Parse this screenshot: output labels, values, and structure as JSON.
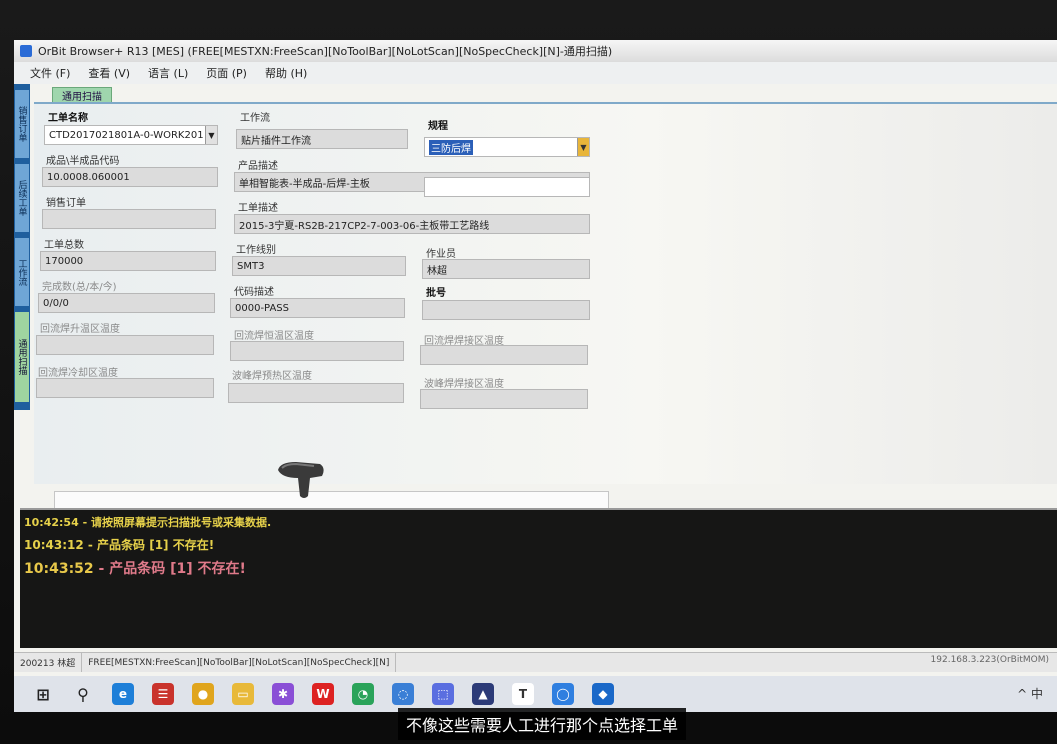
{
  "window": {
    "title": "OrBit Browser+ R13 [MES] (FREE[MESTXN:FreeScan][NoToolBar][NoLotScan][NoSpecCheck][N]-通用扫描)"
  },
  "menu": [
    "文件 (F)",
    "查看 (V)",
    "语言 (L)",
    "页面 (P)",
    "帮助 (H)"
  ],
  "side_tabs": [
    "销售订单",
    "后续工单",
    "工作流",
    "通用扫描"
  ],
  "form_tab": "通用扫描",
  "fields": {
    "work_order_name": {
      "label": "工单名称",
      "value": "CTD2017021801A-0-WORK201"
    },
    "product_code": {
      "label": "成品\\半成品代码",
      "value": "10.0008.060001"
    },
    "sales_order": {
      "label": "销售订单",
      "value": ""
    },
    "order_total": {
      "label": "工单总数",
      "value": "170000"
    },
    "completed": {
      "label": "完成数(总/本/今)",
      "value": "0/0/0"
    },
    "reflow_rise": {
      "label": "回流焊升温区温度",
      "value": ""
    },
    "reflow_cool": {
      "label": "回流焊冷却区温度",
      "value": ""
    },
    "workflow": {
      "label": "工作流",
      "value": "贴片插件工作流"
    },
    "product_desc": {
      "label": "产品描述",
      "value": "单相智能表-半成品-后焊-主板"
    },
    "order_desc": {
      "label": "工单描述",
      "value": "2015-3宁夏-RS2B-217CP2-7-003-06-主板带工艺路线"
    },
    "line": {
      "label": "工作线别",
      "value": "SMT3"
    },
    "code_desc": {
      "label": "代码描述",
      "value": "0000-PASS"
    },
    "reflow_const": {
      "label": "回流焊恒温区温度",
      "value": ""
    },
    "wave_preheat": {
      "label": "波峰焊预热区温度",
      "value": ""
    },
    "procedure": {
      "label": "规程",
      "value": "三防后焊"
    },
    "operator": {
      "label": "作业员",
      "value": "林超"
    },
    "batch": {
      "label": "批号",
      "value": ""
    },
    "reflow_weld": {
      "label": "回流焊焊接区温度",
      "value": ""
    },
    "wave_weld": {
      "label": "波峰焊焊接区温度",
      "value": ""
    }
  },
  "log": [
    {
      "time": "10:42:54",
      "msg": " - 请按照屏幕提示扫描批号或采集数据."
    },
    {
      "time": "10:43:12",
      "msg": " - 产品条码 [1] 不存在!"
    },
    {
      "time": "10:43:52",
      "msg": " - 产品条码 [1] 不存在!"
    }
  ],
  "status": {
    "user": "200213 林超",
    "mode": "FREE[MESTXN:FreeScan][NoToolBar][NoLotScan][NoSpecCheck][N]",
    "server": "192.168.3.223(OrBitMOM)"
  },
  "taskbar": {
    "tray_lang": "中"
  },
  "caption": "不像这些需要人工进行那个点选择工单"
}
